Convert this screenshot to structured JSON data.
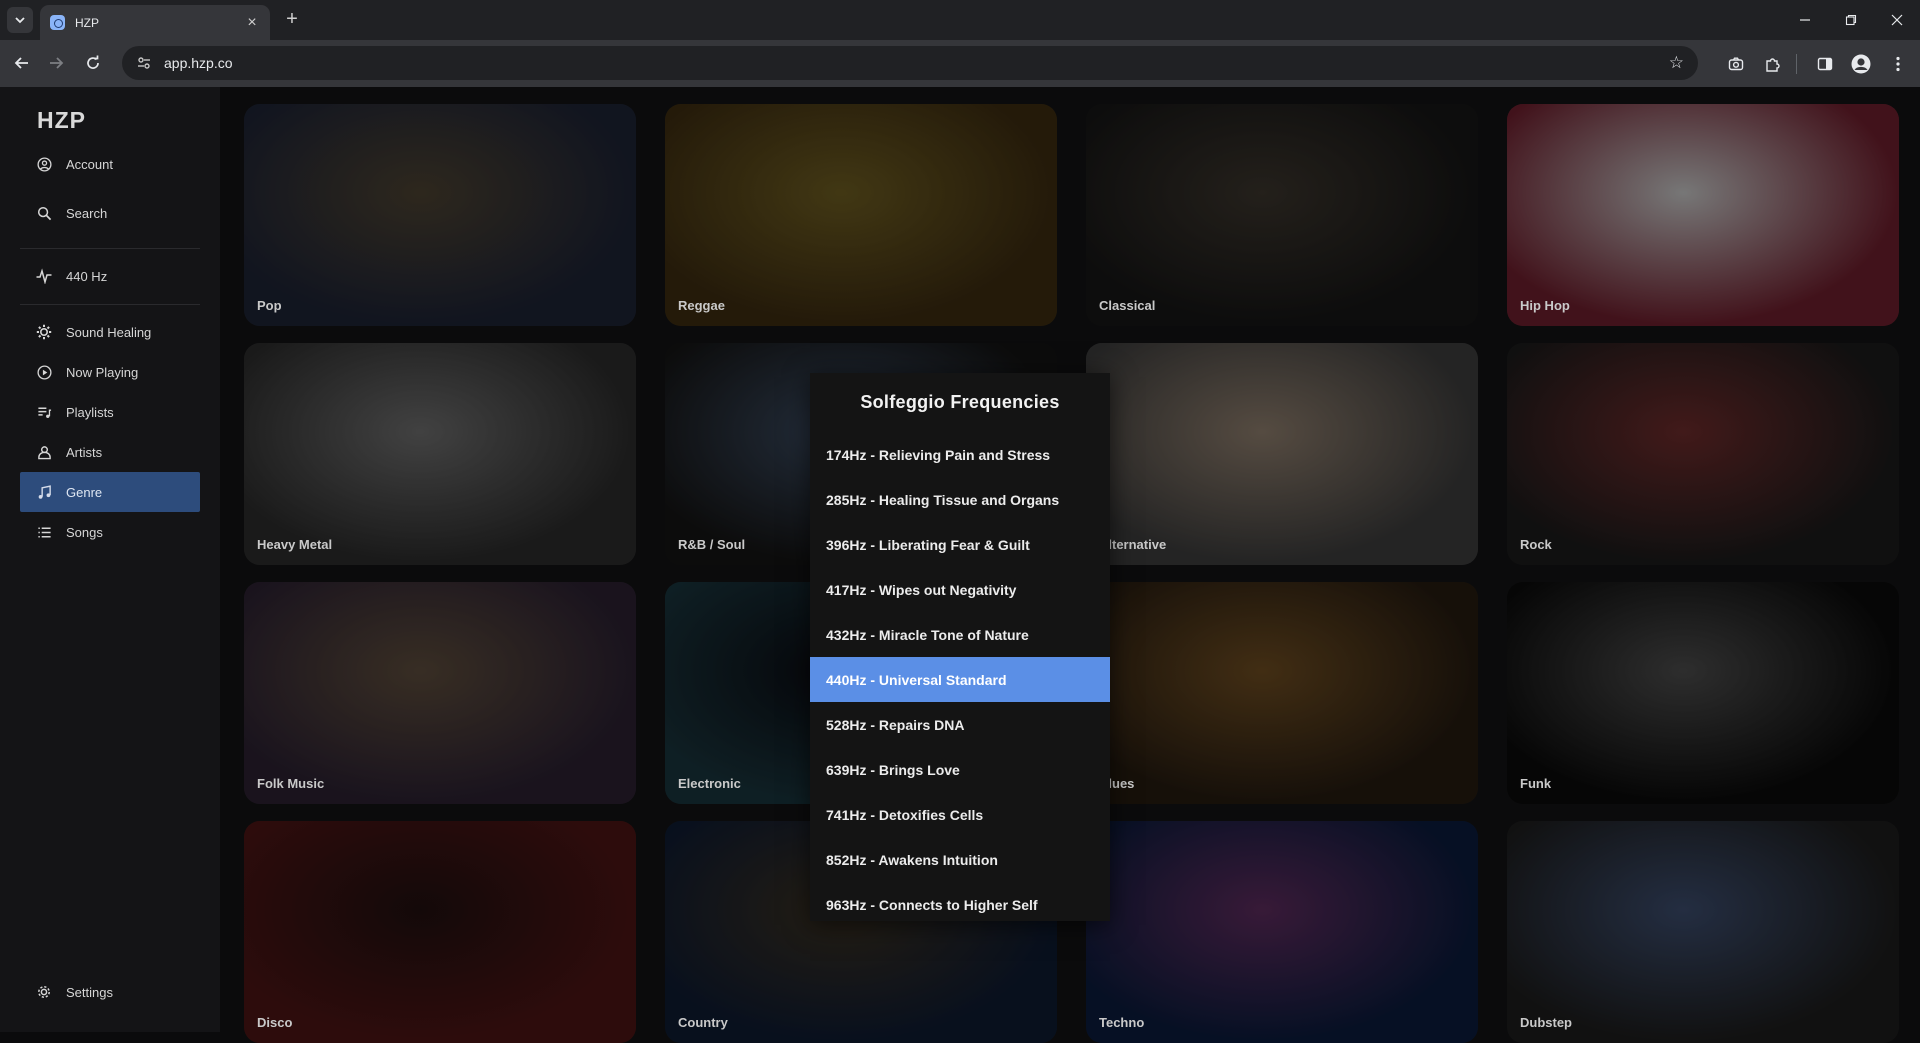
{
  "browser": {
    "tab_title": "HZP",
    "url": "app.hzp.co"
  },
  "sidebar": {
    "logo": "HZP",
    "account": "Account",
    "search": "Search",
    "tuning": "440 Hz",
    "items": [
      {
        "label": "Sound Healing",
        "icon": "gear-icon"
      },
      {
        "label": "Now Playing",
        "icon": "play-circle-icon"
      },
      {
        "label": "Playlists",
        "icon": "playlist-icon"
      },
      {
        "label": "Artists",
        "icon": "person-icon"
      },
      {
        "label": "Genre",
        "icon": "music-note-icon"
      },
      {
        "label": "Songs",
        "icon": "list-icon"
      }
    ],
    "active_item": "Genre",
    "settings": "Settings"
  },
  "genres": [
    {
      "label": "Pop",
      "c1": "#1c2233",
      "c2": "#4a4030"
    },
    {
      "label": "Reggae",
      "c1": "#3a2a10",
      "c2": "#6a5a20"
    },
    {
      "label": "Classical",
      "c1": "#151515",
      "c2": "#3a342c"
    },
    {
      "label": "Hip Hop",
      "c1": "#6a1e2c",
      "c2": "#c0c0c0"
    },
    {
      "label": "Heavy Metal",
      "c1": "#2a2a2a",
      "c2": "#6a6a6a"
    },
    {
      "label": "R&B / Soul",
      "c1": "#141414",
      "c2": "#3a4a60"
    },
    {
      "label": "Alternative",
      "c1": "#3a3a3a",
      "c2": "#8a7a6a"
    },
    {
      "label": "Rock",
      "c1": "#1a1a1a",
      "c2": "#6a2a2a"
    },
    {
      "label": "Folk Music",
      "c1": "#2a2030",
      "c2": "#5a4a3a"
    },
    {
      "label": "Electronic",
      "c1": "#18323a",
      "c2": "#0a0a10"
    },
    {
      "label": "Blues",
      "c1": "#241a10",
      "c2": "#6a4a20"
    },
    {
      "label": "Funk",
      "c1": "#0a0a0a",
      "c2": "#4a4a4a"
    },
    {
      "label": "Disco",
      "c1": "#4a1414",
      "c2": "#201010"
    },
    {
      "label": "Country",
      "c1": "#0e1a30",
      "c2": "#3a3020"
    },
    {
      "label": "Techno",
      "c1": "#0a1a3a",
      "c2": "#5a2a5a"
    },
    {
      "label": "Dubstep",
      "c1": "#1c1c1c",
      "c2": "#3a4a6a"
    }
  ],
  "solfeggio": {
    "title": "Solfeggio Frequencies",
    "options": [
      "174Hz - Relieving Pain and Stress",
      "285Hz - Healing Tissue and Organs",
      "396Hz - Liberating Fear & Guilt",
      "417Hz - Wipes out Negativity",
      "432Hz - Miracle Tone of Nature",
      "440Hz - Universal Standard",
      "528Hz - Repairs DNA",
      "639Hz - Brings Love",
      "741Hz - Detoxifies Cells",
      "852Hz - Awakens Intuition",
      "963Hz - Connects to Higher Self"
    ],
    "selected_index": 5,
    "selected_color": "#5b8fe6"
  }
}
